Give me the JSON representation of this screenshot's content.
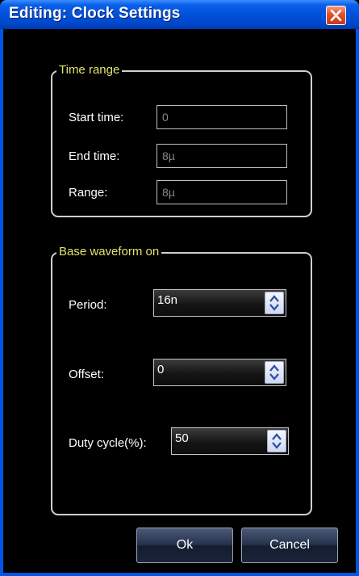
{
  "window": {
    "title": "Editing: Clock Settings",
    "close_icon": "close-icon"
  },
  "time_range": {
    "legend": "Time range",
    "start_label": "Start time:",
    "start_value": "0",
    "end_label": "End time:",
    "end_value": "8µ",
    "range_label": "Range:",
    "range_value": "8µ"
  },
  "base_waveform": {
    "legend": "Base waveform on",
    "period_label": "Period:",
    "period_value": "16n",
    "offset_label": "Offset:",
    "offset_value": "0",
    "duty_label": "Duty cycle(%):",
    "duty_value": "50",
    "spinner_icon": "up-down-arrows-icon"
  },
  "buttons": {
    "ok_label": "Ok",
    "cancel_label": "Cancel"
  },
  "colors": {
    "titlebar": "#0052dc",
    "legend_text": "#e3e36a",
    "background": "#000000",
    "close_button": "#e2522c"
  }
}
